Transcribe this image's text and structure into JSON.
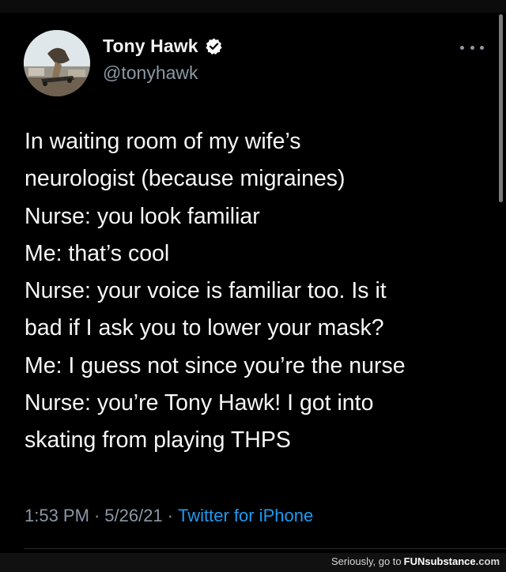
{
  "tweet": {
    "author": {
      "display_name": "Tony Hawk",
      "handle": "@tonyhawk",
      "avatar_icon": "profile-photo-skater",
      "verified_icon": "verified-badge-icon"
    },
    "more_icon": "more-options-icon",
    "lines": [
      "In waiting room of my wife’s",
      "neurologist (because migraines)",
      "Nurse: you look familiar",
      "Me: that’s cool",
      "Nurse: your voice is familiar too. Is it",
      "bad if I ask you to lower your mask?",
      "Me: I guess not since you’re the nurse",
      "Nurse: you’re Tony Hawk! I got into",
      "skating from playing THPS"
    ],
    "meta": {
      "time": "1:53 PM",
      "separator": "·",
      "date": "5/26/21",
      "source": "Twitter for iPhone"
    }
  },
  "watermark": {
    "prefix": "Seriously, go to",
    "brand_part1": "FUN",
    "brand_part2": "substance",
    "brand_part3": ".com"
  },
  "colors": {
    "background": "#000000",
    "text": "#f7f7f7",
    "secondary_text": "#8b98a5",
    "link": "#1d9bf0"
  }
}
